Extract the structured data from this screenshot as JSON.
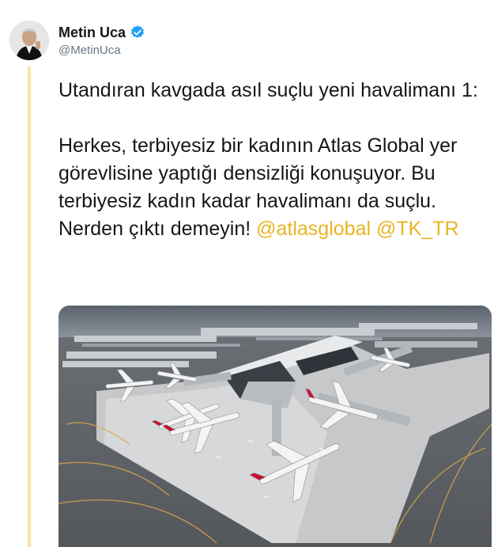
{
  "user": {
    "display_name": "Metin Uca",
    "handle": "@MetinUca",
    "avatar_icon": "person-portrait-icon",
    "verified_icon": "verified-badge-icon"
  },
  "tweet": {
    "line1": "Utandıran kavgada asıl suçlu yeni havalimanı 1:",
    "line2_text": "Herkes, terbiyesiz bir kadının Atlas Global yer görevlisine yaptığı densizliği konuşuyor. Bu terbiyesiz kadın kadar havalimanı da suçlu. Nerden çıktı demeyin!",
    "mention1": "@atlasglobal",
    "mention2": "@TK_TR"
  },
  "colors": {
    "mention": "#e8b422",
    "thread_line": "#f7e3a1",
    "verified": "#1da1f2"
  },
  "photo": {
    "icon": "airport-aerial-photo"
  }
}
